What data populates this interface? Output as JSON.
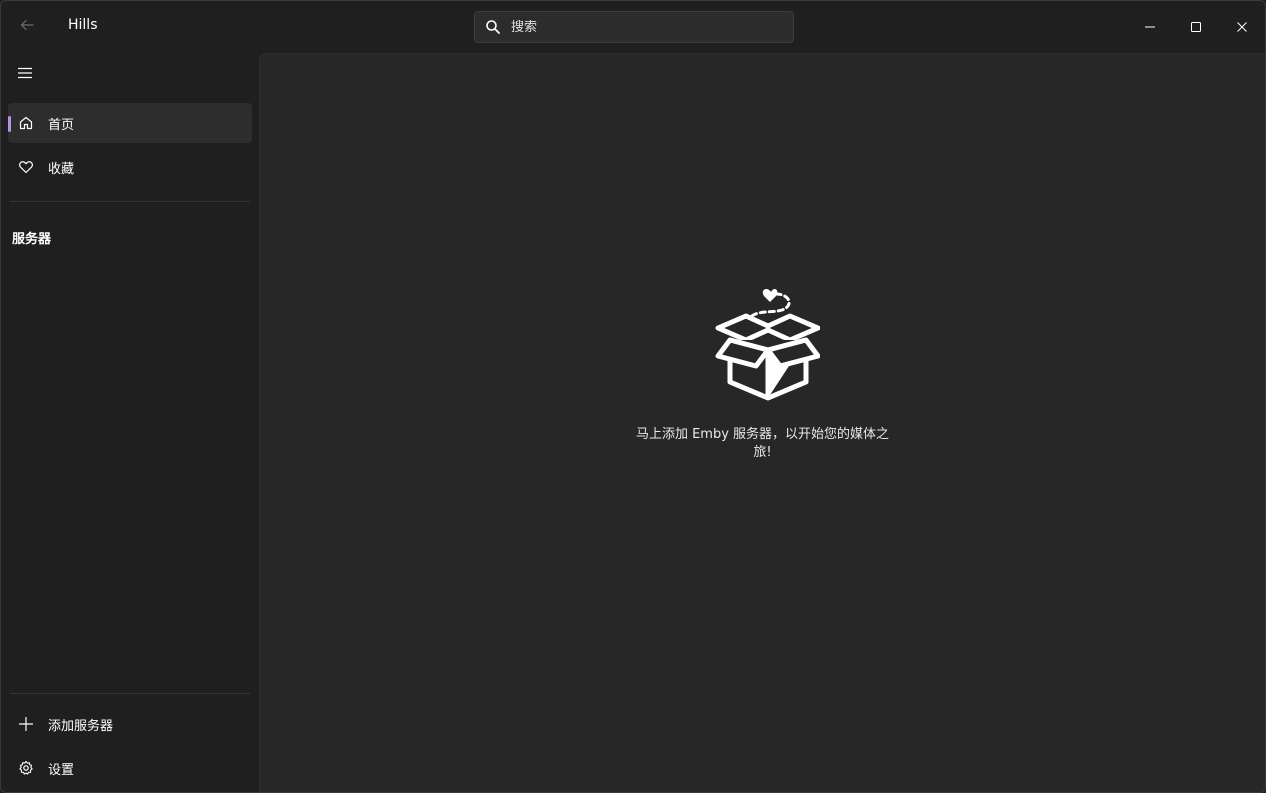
{
  "window": {
    "title": "Hills"
  },
  "search": {
    "placeholder": "搜索"
  },
  "sidebar": {
    "items": [
      {
        "label": "首页",
        "icon": "home-icon",
        "active": true
      },
      {
        "label": "收藏",
        "icon": "heart-icon",
        "active": false
      }
    ],
    "section_header": "服务器",
    "footer_items": [
      {
        "label": "添加服务器",
        "icon": "plus-icon"
      },
      {
        "label": "设置",
        "icon": "gear-icon"
      }
    ]
  },
  "main": {
    "empty_icon": "open-box-icon",
    "empty_message": "马上添加 Emby 服务器，以开始您的媒体之旅!"
  },
  "colors": {
    "accent": "#b692de",
    "sidebar_bg": "#1f1f1f",
    "content_bg": "#272727",
    "active_item_bg": "#2d2d2d"
  }
}
